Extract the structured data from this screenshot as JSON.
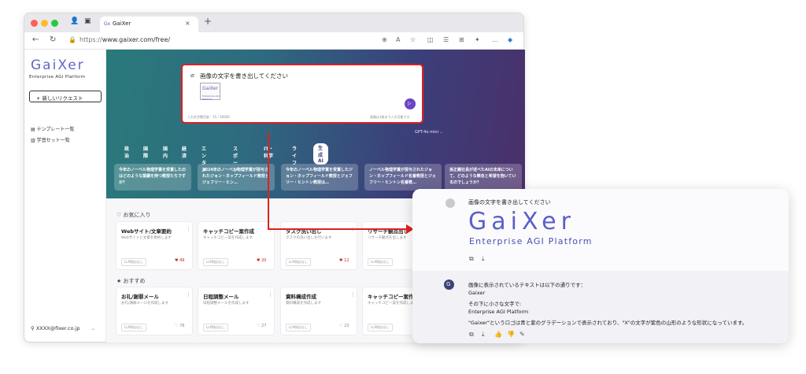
{
  "browser": {
    "tab_title": "GaiXer",
    "url_prefix": "https://",
    "url_host": "www.gaixer.com/free/"
  },
  "sidebar": {
    "logo": "GaiXer",
    "logo_sub": "Enterprise AGI Platform",
    "new_request": "+ 新しいリクエスト",
    "menu": [
      "テンプレート一覧",
      "学習セット一覧"
    ],
    "user": "XXXX@fixer.co.jp"
  },
  "hero": {
    "input_text": "画像の文字を書き出してください",
    "thumb_title": "GaiXer",
    "thumb_sub": "Enterprise AGI Platform",
    "footer_left": "入力文字数目安：15 / 16000",
    "footer_right": "画像は1枚まで入力可能です",
    "model": "GPT-4o mini",
    "categories": [
      "政治",
      "国際",
      "国内",
      "経済",
      "エンタメ",
      "スポーツ",
      "IT・科学",
      "ライフ"
    ],
    "active_category": "生成AI",
    "topics": [
      "今年のノーベル物理学賞を受賞したのはどのような業績を持つ教授たちですか？",
      "2024年のノーベル物理学賞が授与されたジョン・ホップフィールド教授とジェフリー・ヒン…",
      "今年のノーベル物理学賞を受賞したジョン・ホップフィールド教授とジェフリー・ヒントン教授は…",
      "ノーベル物理学賞が授与されたジョン・ホップフィールド名誉教授とジェフリー・ヒントン名誉教…",
      "孫正義社長が述べたAIの未来について、どのような懸念と希望を抱いているのでしょうか？"
    ]
  },
  "favorites": {
    "label": "♡ お気に入り",
    "cards": [
      {
        "title": "Webサイト/文章要約",
        "desc": "Webサイトと文章を要約します",
        "badge": "LLM独自なし",
        "likes": "49"
      },
      {
        "title": "キャッチコピー案作成",
        "desc": "キャッチコピー案を作成します",
        "badge": "LLM独自なし",
        "likes": "20"
      },
      {
        "title": "タスク洗い出し",
        "desc": "タスクの洗い出しを行います",
        "badge": "LLM独自なし",
        "likes": "12"
      },
      {
        "title": "リサーチ観点出し",
        "desc": "リサーチ観点を出します",
        "badge": "LLM独自なし",
        "likes": ""
      }
    ]
  },
  "recommended": {
    "label": "★ おすすめ",
    "cards": [
      {
        "title": "お礼/謝罪メール",
        "desc": "お礼/謝罪メールを作成します",
        "badge": "LLM独自なし",
        "likes": "78"
      },
      {
        "title": "日程調整メール",
        "desc": "日程調整メールを作成します",
        "badge": "LLM独自なし",
        "likes": "27"
      },
      {
        "title": "資料構成作成",
        "desc": "資料構成を作成します",
        "badge": "LLM独自なし",
        "likes": "23"
      },
      {
        "title": "キャッチコピー案作成",
        "desc": "キャッチコピー案を作成します",
        "badge": "LLM独自なし",
        "likes": ""
      }
    ]
  },
  "zoom": {
    "user_prompt": "画像の文字を書き出してください",
    "image_logo": "GaiXer",
    "image_sub": "Enterprise AGI Platform",
    "answer": [
      "画像に表示されているテキストは以下の通りです：",
      "Gaixer",
      "その下に小さな文字で:",
      "Enterprise AGI Platform",
      "\"Gaixer\"というロゴは青と紫のグラデーションで表示されており、\"X\"の文字が紫色の山形のような形状になっています。"
    ]
  },
  "colors": {
    "accent": "#6b46c1",
    "highlight": "#e02020",
    "logo": "#5b5fc7"
  }
}
